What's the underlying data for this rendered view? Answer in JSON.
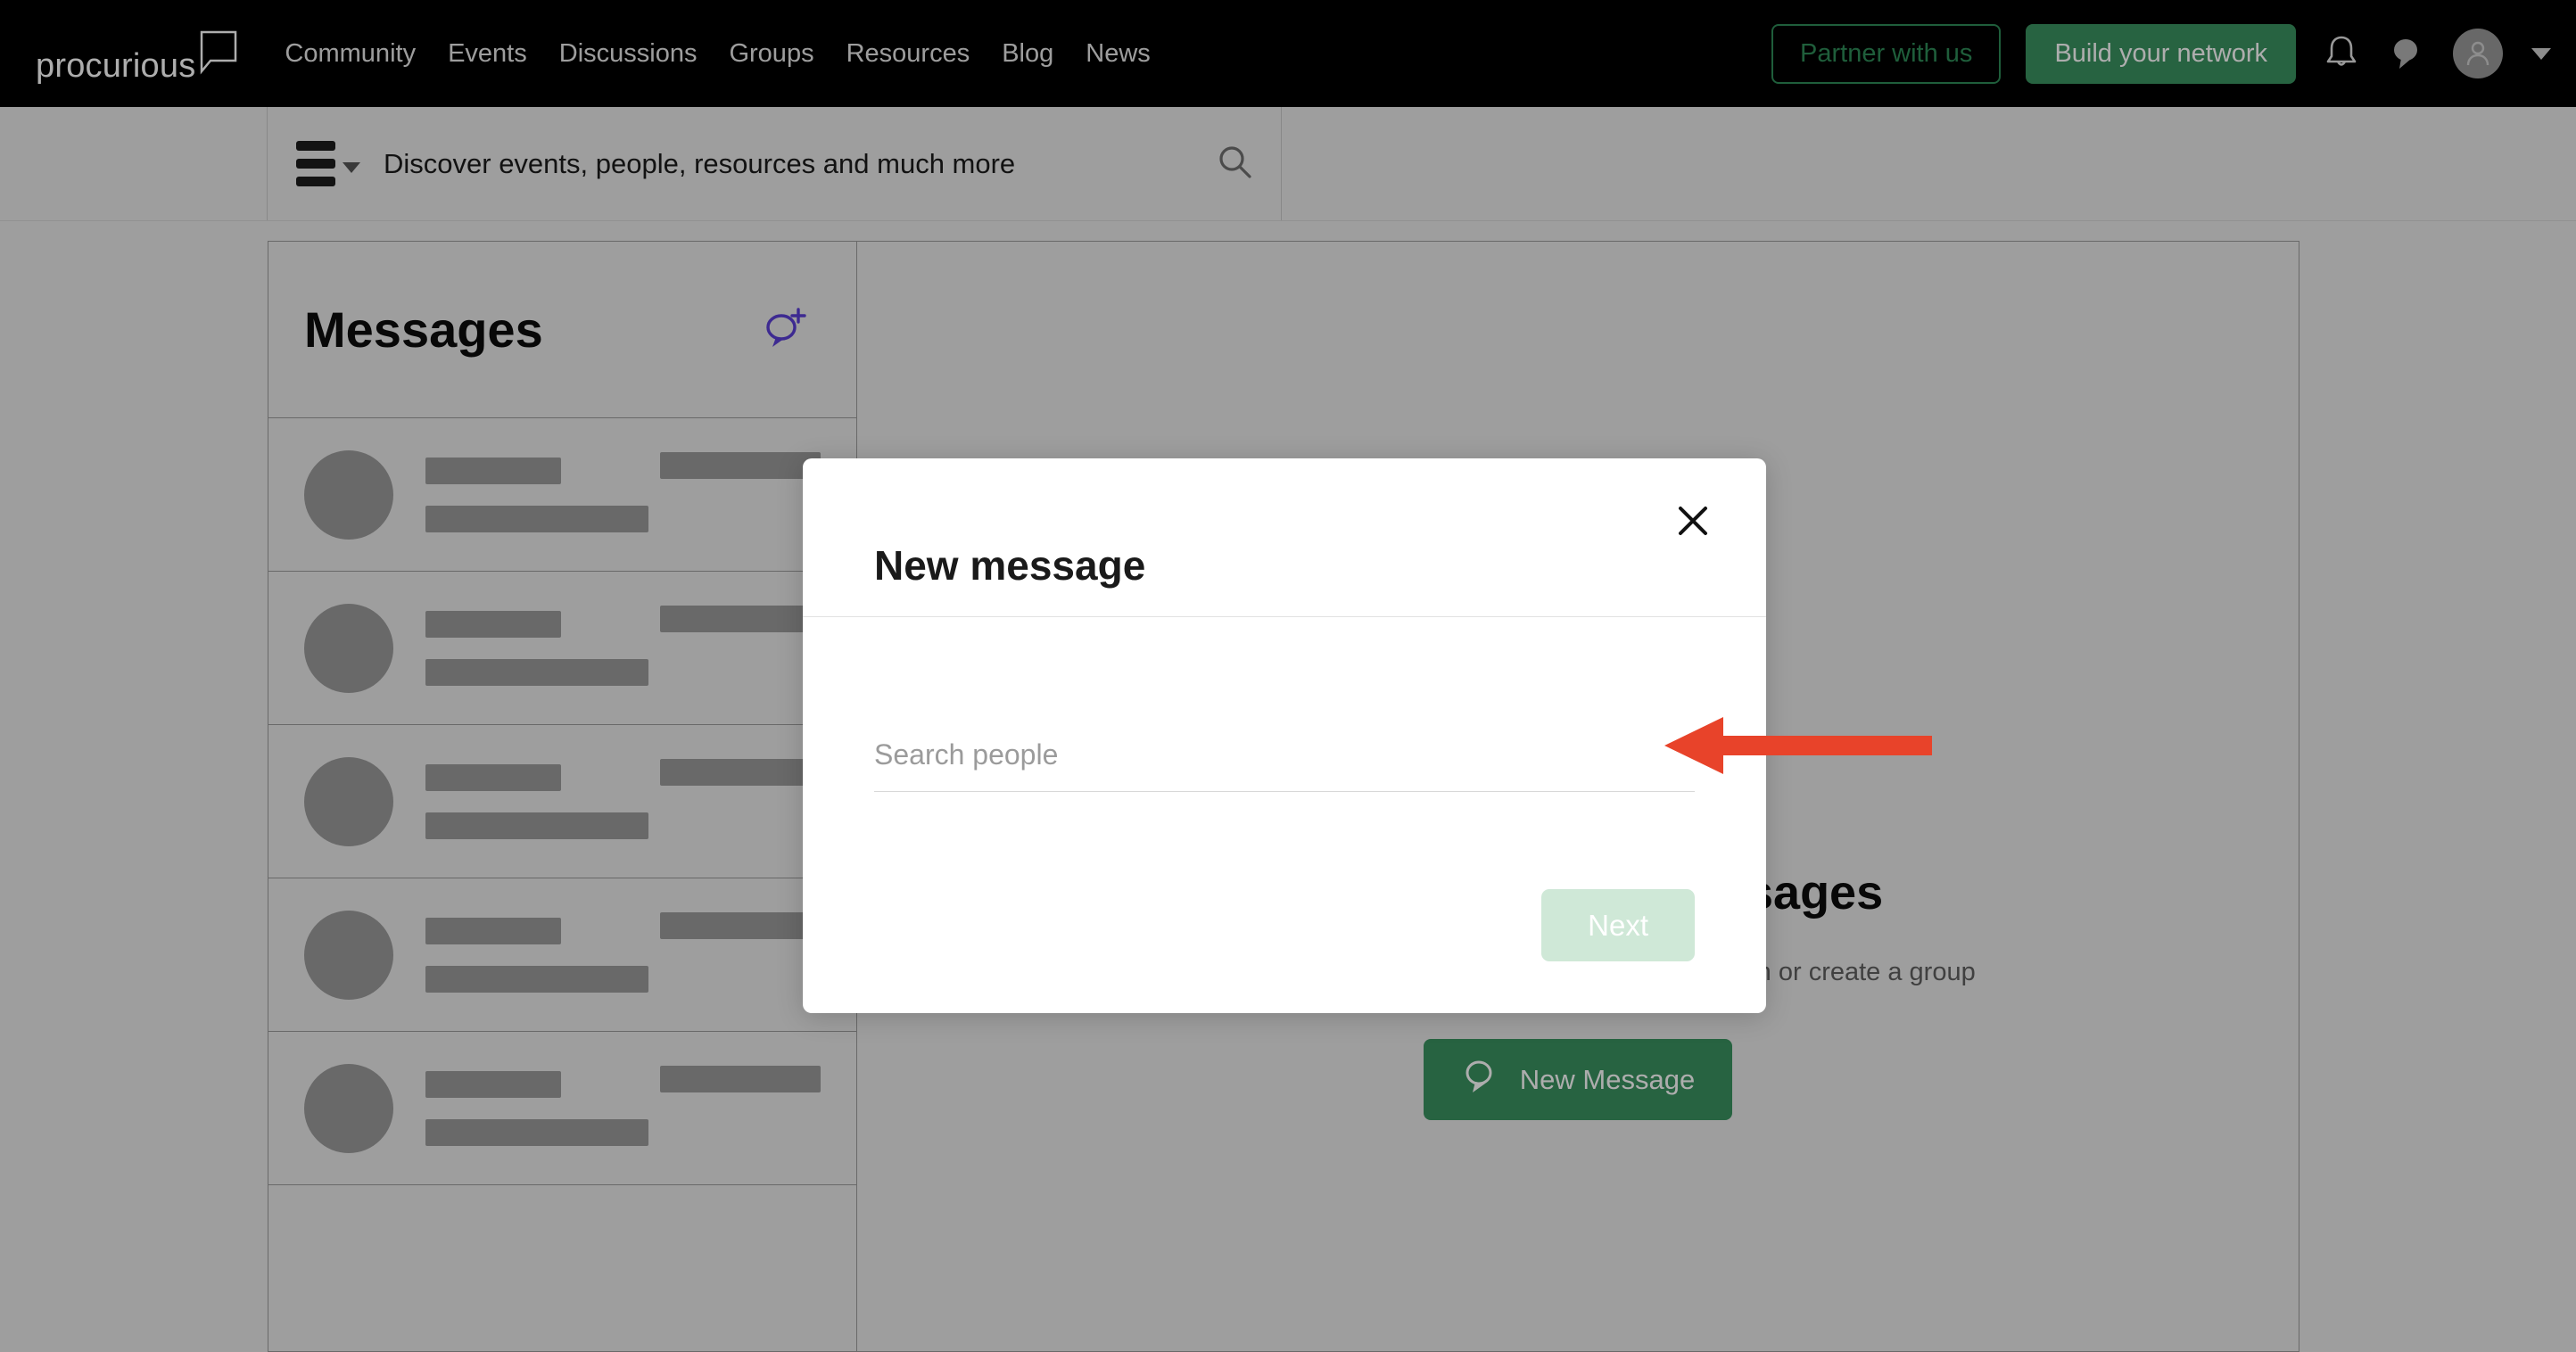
{
  "topnav": {
    "brand": "procurious",
    "brand_mark_icon": "speech-bubble-outline-icon",
    "links": [
      {
        "label": "Community"
      },
      {
        "label": "Events"
      },
      {
        "label": "Discussions"
      },
      {
        "label": "Groups"
      },
      {
        "label": "Resources"
      },
      {
        "label": "Blog"
      },
      {
        "label": "News"
      }
    ],
    "partner_button": "Partner with us",
    "network_button": "Build your network",
    "notifications_icon": "bell-icon",
    "messages_icon": "chat-bubble-icon",
    "avatar_icon": "user-avatar-icon",
    "account_caret_icon": "chevron-down-icon",
    "colors": {
      "bar_background": "#000000",
      "outline_button_border": "#2e8b57",
      "solid_button_background": "#3a9260"
    }
  },
  "searchbar": {
    "menu_icon": "hamburger-menu-icon",
    "menu_caret_icon": "chevron-down-icon",
    "placeholder": "Discover events, people, resources and much more",
    "value": "",
    "search_icon": "search-icon"
  },
  "messages_panel": {
    "title": "Messages",
    "new_conversation_icon": "new-chat-icon",
    "new_conversation_icon_color": "#5b3fd6",
    "skeleton_rows": 5
  },
  "empty_state": {
    "illustration_icon": "message-list-illustration-icon",
    "title": "Get started with messages",
    "subtitle": "Choose one of your contacts to start a conversation or create a group",
    "button_label": "New Message",
    "button_icon": "chat-bubble-icon",
    "button_color": "#3a9260"
  },
  "modal": {
    "title": "New message",
    "close_icon": "close-icon",
    "search_input": {
      "placeholder": "Search people",
      "value": ""
    },
    "next_button": {
      "label": "Next",
      "disabled": true,
      "background": "#cfe8d7",
      "text_color": "#ffffff"
    }
  },
  "annotation": {
    "arrow_icon": "left-pointing-arrow-annotation",
    "color": "#e8432a",
    "points_at": "search-people-input"
  }
}
